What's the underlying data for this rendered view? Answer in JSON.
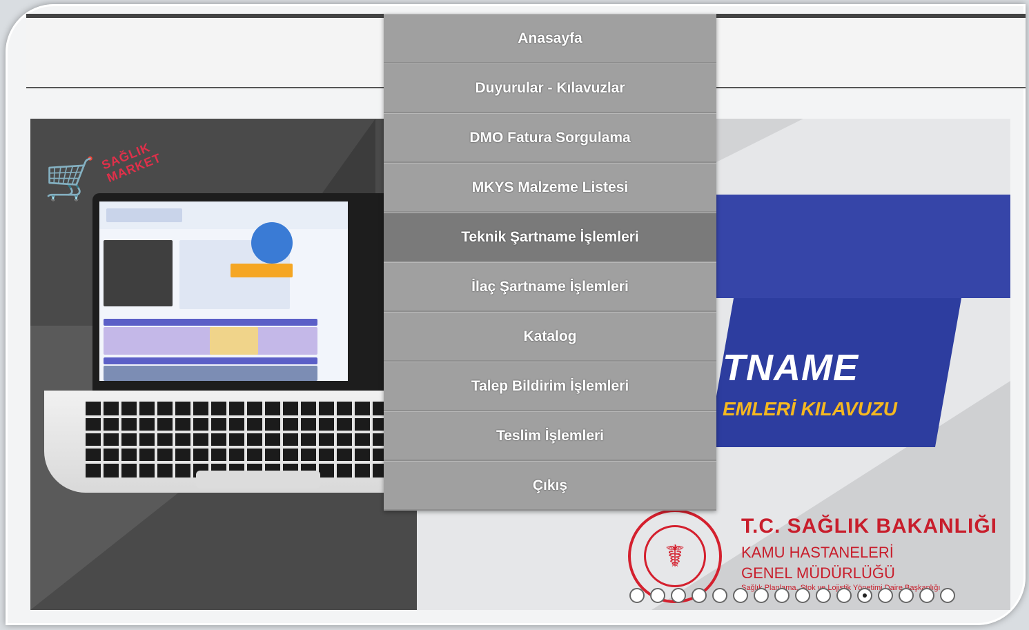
{
  "menu": {
    "items": [
      {
        "label": "Anasayfa",
        "active": false
      },
      {
        "label": "Duyurular - Kılavuzlar",
        "active": false
      },
      {
        "label": "DMO Fatura Sorgulama",
        "active": false
      },
      {
        "label": "MKYS Malzeme Listesi",
        "active": false
      },
      {
        "label": "Teknik Şartname İşlemleri",
        "active": true
      },
      {
        "label": "İlaç Şartname İşlemleri",
        "active": false
      },
      {
        "label": "Katalog",
        "active": false
      },
      {
        "label": "Talep Bildirim İşlemleri",
        "active": false
      },
      {
        "label": "Teslim İşlemleri",
        "active": false
      },
      {
        "label": "Çıkış",
        "active": false
      }
    ]
  },
  "slider": {
    "market_logo": "SAĞLIK\nMARKET",
    "banner_title": "TNAME",
    "banner_subtitle": "EMLERİ KILAVUZU",
    "ministry_title": "T.C. SAĞLIK BAKANLIĞI",
    "ministry_line1": "KAMU HASTANELERİ",
    "ministry_line2": "GENEL MÜDÜRLÜĞÜ",
    "ministry_small": "Sağlık Planlama, Stok ve Lojistik Yönetimi Daire Başkanlığı",
    "dot_count": 16,
    "active_dot": 11
  },
  "colors": {
    "menu_bg": "#a0a0a0",
    "menu_active_bg": "#7a7a7a",
    "banner_blue": "#3645a8",
    "accent_yellow": "#f5b820",
    "ministry_red": "#c81e2c"
  }
}
